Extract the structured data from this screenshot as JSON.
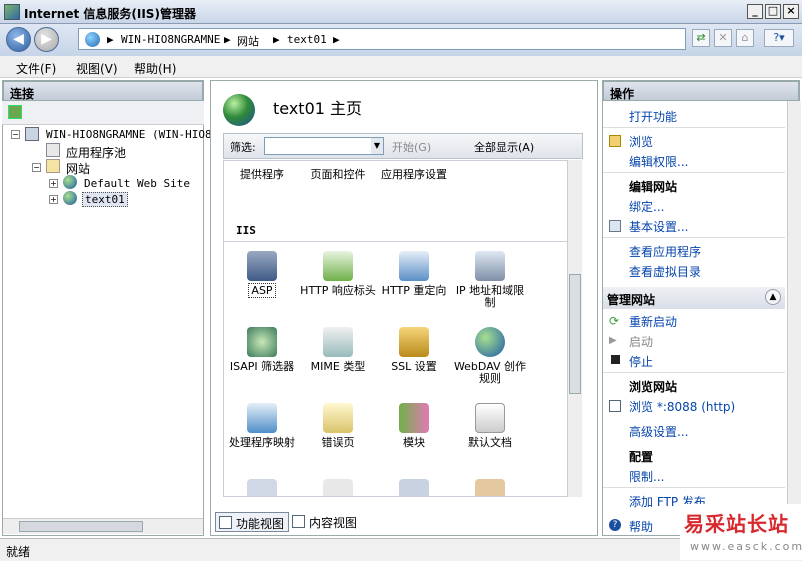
{
  "window": {
    "title": "Internet 信息服务(IIS)管理器"
  },
  "address": {
    "crumbs": [
      "WIN-HIO8NGRAMNE",
      "网站",
      "text01"
    ]
  },
  "menu": {
    "items": [
      "文件(F)",
      "视图(V)",
      "帮助(H)"
    ]
  },
  "connections": {
    "title": "连接",
    "tree": {
      "server": "WIN-HIO8NGRAMNE (WIN-HIO8N",
      "app_pools": "应用程序池",
      "sites": "网站",
      "site1": "Default Web Site",
      "site2": "text01"
    }
  },
  "center": {
    "title": "text01 主页",
    "filter": {
      "label": "筛选:",
      "value": "",
      "start": "开始(G)",
      "show_all": "全部显示(A)"
    },
    "section_iis": "IIS",
    "features_top": [
      "提供程序",
      "页面和控件",
      "应用程序设置"
    ],
    "features": [
      "ASP",
      "HTTP 响应标头",
      "HTTP 重定向",
      "IP 地址和域限制",
      "ISAPI 筛选器",
      "MIME 类型",
      "SSL 设置",
      "WebDAV 创作规则",
      "处理程序映射",
      "错误页",
      "模块",
      "默认文档"
    ],
    "view_tabs": {
      "feature_view": "功能视图",
      "content_view": "内容视图"
    }
  },
  "actions": {
    "title": "操作",
    "open_feature": "打开功能",
    "browse": "浏览",
    "edit_permissions": "编辑权限...",
    "edit_site_head": "编辑网站",
    "bindings": "绑定...",
    "basic_settings": "基本设置...",
    "view_apps": "查看应用程序",
    "view_vdirs": "查看虚拟目录",
    "manage_site_head": "管理网站",
    "restart": "重新启动",
    "start": "启动",
    "stop": "停止",
    "browse_site_head": "浏览网站",
    "browse_port": "浏览 *:8088 (http)",
    "advanced_settings": "高级设置...",
    "config_head": "配置",
    "limits": "限制...",
    "add_ftp": "添加 FTP 发布...",
    "help": "帮助"
  },
  "status": {
    "text": "就绪"
  },
  "watermark": {
    "line1": "易采站长站",
    "line2": "www.easck.com"
  },
  "colors": {
    "link": "#0645ad",
    "watermark_red": "#d8282e"
  }
}
